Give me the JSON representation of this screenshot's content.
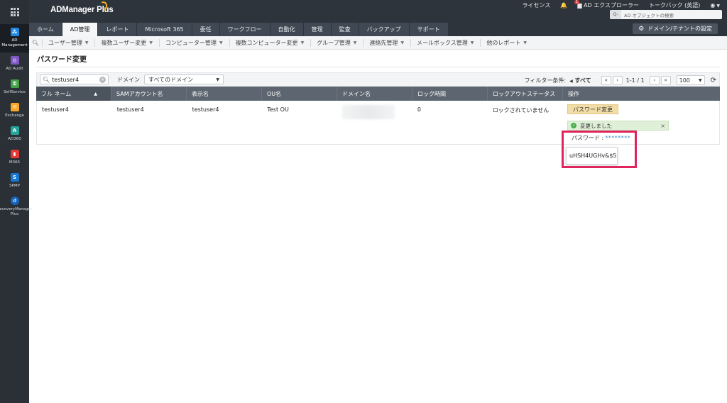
{
  "header": {
    "logo": "ADManager Plus",
    "links": {
      "license": "ライセンス",
      "notification_count": "1",
      "ad_explorer": "AD エクスプローラー",
      "talkback": "トークバック (英語)"
    },
    "search_placeholder": "AD オブジェクトの検索",
    "domain_settings": "ドメイン/テナントの設定"
  },
  "tabs": [
    "ホーム",
    "AD管理",
    "レポート",
    "Microsoft 365",
    "委任",
    "ワークフロー",
    "自動化",
    "管理",
    "監査",
    "バックアップ",
    "サポート"
  ],
  "rail": [
    "AD Management",
    "AD Audit",
    "SelfService",
    "Exchange",
    "AD360",
    "M365",
    "SPMP",
    "RecoveryManager Plus"
  ],
  "submenu": [
    "ユーザー管理",
    "複数ユーザー変更",
    "コンピューター管理",
    "複数コンピューター変更",
    "グループ管理",
    "連絡先管理",
    "メールボックス管理",
    "他のレポート"
  ],
  "page": {
    "title": "パスワード変更"
  },
  "filter": {
    "search_value": "testuser4",
    "domain_label": "ドメイン",
    "domain_value": "すべてのドメイン",
    "filter_label": "フィルター条件:",
    "filter_value": "すべて",
    "page_range": "1-1 / 1",
    "page_size": "100"
  },
  "table": {
    "columns": [
      "フル ネーム",
      "SAMアカウント名",
      "表示名",
      "OU名",
      "ドメイン名",
      "ロック時間",
      "ロックアウトステータス",
      "操作"
    ],
    "row": {
      "full_name": "testuser4",
      "sam": "testuser4",
      "display": "testuser4",
      "ou": "Test OU",
      "lock_time": "0",
      "lockout_status": "ロックされていません"
    }
  },
  "action": {
    "button": "パスワード変更",
    "success_msg": "変更しました",
    "password_label": "パスワード :",
    "password_mask": "********",
    "password_revealed": "uHSH4UGHv&$5"
  },
  "colors": {
    "accent": "#f2dda8",
    "highlight": "#e0245e",
    "success": "#dff0d8"
  }
}
